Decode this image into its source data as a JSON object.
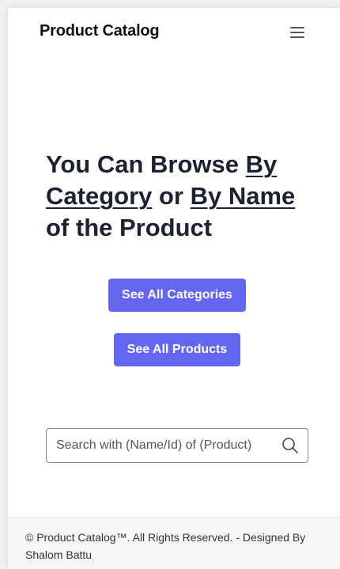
{
  "header": {
    "brand": "Product Catalog",
    "menu_icon": "hamburger-menu-icon"
  },
  "hero": {
    "part1": "You Can Browse ",
    "link_by": "By",
    "link_category": "Category",
    "part2": " or ",
    "link_by_name": "By Name",
    "part3": " of the Product"
  },
  "actions": {
    "see_all_categories": "See All Categories",
    "see_all_products": "See All Products"
  },
  "search": {
    "placeholder": "Search with (Name/Id) of (Product)",
    "value": "",
    "icon": "search-icon"
  },
  "footer": {
    "text": "© Product Catalog™. All Rights Reserved. - Designed By Shalom Battu"
  },
  "colors": {
    "accent": "#6366f1",
    "text": "#1c2230"
  }
}
